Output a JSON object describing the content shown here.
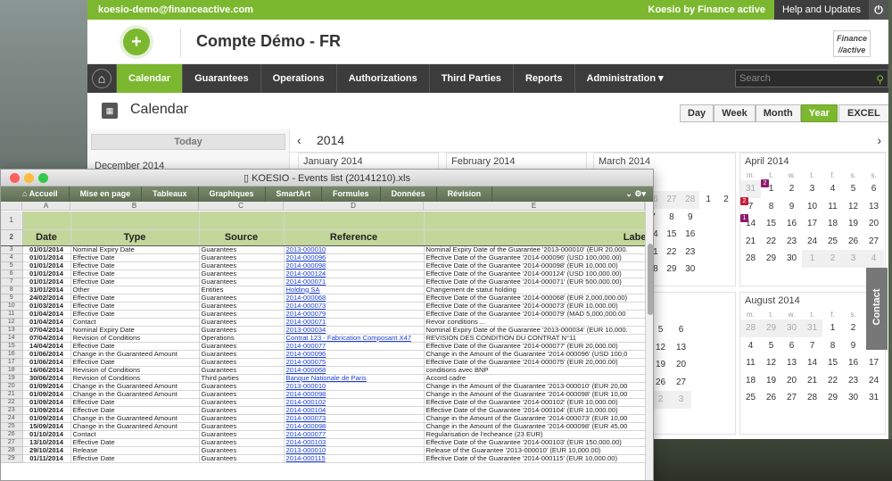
{
  "topbar": {
    "user": "koesio-demo@financeactive.com",
    "brand": "Koesio by Finance active",
    "help": "Help and Updates"
  },
  "header": {
    "title": "Compte Démo - FR",
    "brand_logo_line1": "Finance",
    "brand_logo_line2": "//active"
  },
  "nav": {
    "items": [
      "Calendar",
      "Guarantees",
      "Operations",
      "Authorizations",
      "Third Parties",
      "Reports",
      "Administration"
    ],
    "active": "Calendar",
    "search_placeholder": "Search"
  },
  "page": {
    "title": "Calendar",
    "views": [
      "Day",
      "Week",
      "Month",
      "Year"
    ],
    "active_view": "Year",
    "excel": "EXCEL"
  },
  "sidebar": {
    "today": "Today",
    "month": "December 2014"
  },
  "year": {
    "label": "2014",
    "prev": "‹",
    "next": "›"
  },
  "months": {
    "jan": "January 2014",
    "feb": "February 2014",
    "mar": "March 2014",
    "apr": "April 2014",
    "aug": "August 2014"
  },
  "weekdays": [
    "m.",
    "t.",
    "w.",
    "t.",
    "f.",
    "s.",
    "s."
  ],
  "contact": "Contact",
  "excel": {
    "title": "KOESIO - Events list (20141210).xls",
    "ribbon": [
      "Accueil",
      "Mise en page",
      "Tableaux",
      "Graphiques",
      "SmartArt",
      "Formules",
      "Données",
      "Révision"
    ],
    "cols": [
      "A",
      "B",
      "C",
      "D",
      "E"
    ],
    "headers": [
      "Date",
      "Type",
      "Source",
      "Reference",
      "Label"
    ],
    "rows": [
      [
        "01/01/2014",
        "Nominal Expiry Date",
        "Guarantees",
        "2013-000010",
        "Nominal Expiry Date of the Guarantee '2013-000010' (EUR 20,000."
      ],
      [
        "01/01/2014",
        "Effective Date",
        "Guarantees",
        "2014-000096",
        "Effective Date of the Guarantee '2014-000096' (USD 100,000.00)"
      ],
      [
        "01/01/2014",
        "Effective Date",
        "Guarantees",
        "2014-000098",
        "Effective Date of the Guarantee '2014-000098' (EUR 10,000.00)"
      ],
      [
        "01/01/2014",
        "Effective Date",
        "Guarantees",
        "2014-000124",
        "Effective Date of the Guarantee '2014-000124' (USD 100,000.00)"
      ],
      [
        "01/01/2014",
        "Effective Date",
        "Guarantees",
        "2014-000071",
        "Effective Date of the Guarantee '2014-000071' (EUR 500,000.00)"
      ],
      [
        "31/01/2014",
        "Other",
        "Entities",
        "Holding SA",
        "Changement de statut holding"
      ],
      [
        "24/02/2014",
        "Effective Date",
        "Guarantees",
        "2014-000068",
        "Effective Date of the Guarantee '2014-000068' (EUR 2,000,000.00)"
      ],
      [
        "01/03/2014",
        "Effective Date",
        "Guarantees",
        "2014-000073",
        "Effective Date of the Guarantee '2014-000073' (EUR 10,000.00)"
      ],
      [
        "01/04/2014",
        "Effective Date",
        "Guarantees",
        "2014-000079",
        "Effective Date of the Guarantee '2014-000079' (MAD 5,000,000.00"
      ],
      [
        "01/04/2014",
        "Contact",
        "Guarantees",
        "2014-000071",
        "Revoir conditions ..."
      ],
      [
        "07/04/2014",
        "Nominal Expiry Date",
        "Guarantees",
        "2013-000034",
        "Nominal Expiry Date of the Guarantee '2013-000034' (EUR 10,000."
      ],
      [
        "07/04/2014",
        "Revision of Conditions",
        "Operations",
        "Contrat 123 - Fabrication Composant X47",
        "REVISION DES CONDITION DU CONTRAT N°11"
      ],
      [
        "14/04/2014",
        "Effective Date",
        "Guarantees",
        "2014-000077",
        "Effective Date of the Guarantee '2014-000077' (EUR 20,000.00)"
      ],
      [
        "01/06/2014",
        "Change in the Guaranteed Amount",
        "Guarantees",
        "2014-000096",
        "Change in the Amount of the Guarantee '2014-000096' (USD 100,0"
      ],
      [
        "01/06/2014",
        "Effective Date",
        "Guarantees",
        "2014-000075",
        "Effective Date of the Guarantee '2014-000075' (EUR 20,000.00)"
      ],
      [
        "16/06/2014",
        "Revision of Conditions",
        "Guarantees",
        "2014-000068",
        "conditions avec BNP"
      ],
      [
        "30/06/2014",
        "Revision of Conditions",
        "Third parties",
        "Banque Nationale de Paris",
        "Accord cadre"
      ],
      [
        "01/09/2014",
        "Change in the Guaranteed Amount",
        "Guarantees",
        "2013-000010",
        "Change in the Amount of the Guarantee '2013-000010' (EUR 20,00"
      ],
      [
        "01/09/2014",
        "Change in the Guaranteed Amount",
        "Guarantees",
        "2014-000098",
        "Change in the Amount of the Guarantee '2014-000098' (EUR 10,00"
      ],
      [
        "01/09/2014",
        "Effective Date",
        "Guarantees",
        "2014-000102",
        "Effective Date of the Guarantee '2014-000102' (EUR 10,000.00)"
      ],
      [
        "01/09/2014",
        "Effective Date",
        "Guarantees",
        "2014-000104",
        "Effective Date of the Guarantee '2014-000104' (EUR 10,000.00)"
      ],
      [
        "01/09/2014",
        "Change in the Guaranteed Amount",
        "Guarantees",
        "2014-000073",
        "Change in the Amount of the Guarantee '2014-000073' (EUR 10,00"
      ],
      [
        "15/09/2014",
        "Change in the Guaranteed Amount",
        "Guarantees",
        "2014-000098",
        "Change in the Amount of the Guarantee '2014-000098' (EUR 45,00"
      ],
      [
        "01/10/2014",
        "Contact",
        "Guarantees",
        "2014-000077",
        "Regularisation de l'echeance (23 EUR)"
      ],
      [
        "13/10/2014",
        "Effective Date",
        "Guarantees",
        "2014-000103",
        "Effective Date of the Guarantee '2014-000103' (EUR 150,000.00)"
      ],
      [
        "29/10/2014",
        "Release",
        "Guarantees",
        "2013-000010",
        "Release of the Guarantee '2013-000010' (EUR 10,000.00)"
      ],
      [
        "01/11/2014",
        "Effective Date",
        "Guarantees",
        "2014-000115",
        "Effective Date of the Guarantee '2014-000115' (EUR 10,000.00)"
      ]
    ]
  }
}
